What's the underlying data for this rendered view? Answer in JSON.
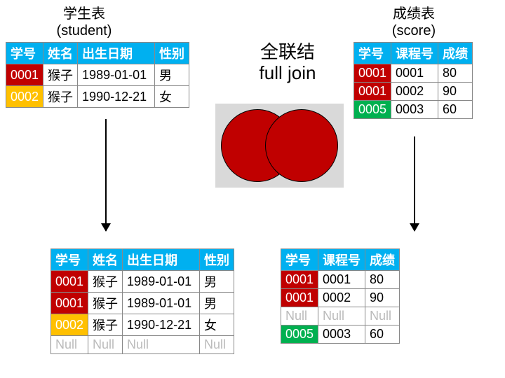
{
  "captions": {
    "student_cn": "学生表",
    "student_en": "(student)",
    "score_cn": "成绩表",
    "score_en": "(score)",
    "join_cn": "全联结",
    "join_en": "full join"
  },
  "student_headers": [
    "学号",
    "姓名",
    "出生日期",
    "性别"
  ],
  "score_headers": [
    "学号",
    "课程号",
    "成绩"
  ],
  "student_top": [
    {
      "id": "0001",
      "cls": "id-red",
      "name": "猴子",
      "dob": "1989-01-01",
      "sex": "男"
    },
    {
      "id": "0002",
      "cls": "id-amber",
      "name": "猴子",
      "dob": "1990-12-21",
      "sex": "女"
    }
  ],
  "score_top": [
    {
      "id": "0001",
      "cls": "id-red",
      "course": "0001",
      "score": "80"
    },
    {
      "id": "0001",
      "cls": "id-red",
      "course": "0002",
      "score": "90"
    },
    {
      "id": "0005",
      "cls": "id-green",
      "course": "0003",
      "score": "60"
    }
  ],
  "student_bottom": [
    {
      "id": "0001",
      "cls": "id-red",
      "name": "猴子",
      "dob": "1989-01-01",
      "sex": "男"
    },
    {
      "id": "0001",
      "cls": "id-red",
      "name": "猴子",
      "dob": "1989-01-01",
      "sex": "男"
    },
    {
      "id": "0002",
      "cls": "id-amber",
      "name": "猴子",
      "dob": "1990-12-21",
      "sex": "女"
    },
    {
      "id": "Null",
      "cls": "null-cell",
      "name": "Null",
      "dob": "Null",
      "sex": "Null"
    }
  ],
  "score_bottom": [
    {
      "id": "0001",
      "cls": "id-red",
      "course": "0001",
      "score": "80"
    },
    {
      "id": "0001",
      "cls": "id-red",
      "course": "0002",
      "score": "90"
    },
    {
      "id": "Null",
      "cls": "null-cell",
      "course": "Null",
      "score": "Null"
    },
    {
      "id": "0005",
      "cls": "id-green",
      "course": "0003",
      "score": "60"
    }
  ],
  "null_token": "Null",
  "colors": {
    "venn_fill": "#c00000",
    "venn_bg": "#d9d9d9"
  }
}
